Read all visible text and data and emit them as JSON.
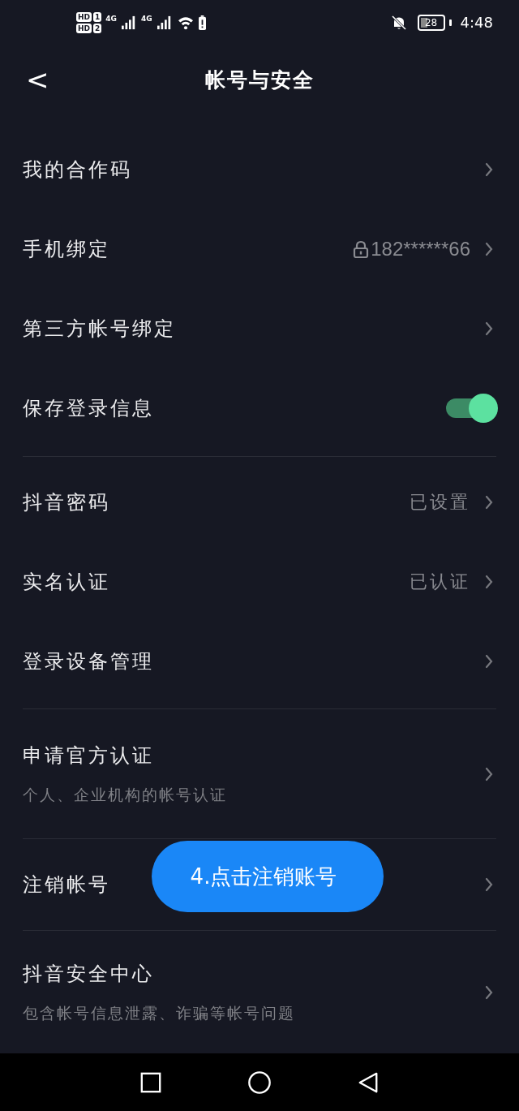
{
  "status_bar": {
    "sim_1": "HD",
    "sim_1_slot": "1",
    "sim_2": "HD",
    "sim_2_slot": "2",
    "network_1": "4G",
    "network_2": "4G",
    "battery": "28",
    "time": "4:48"
  },
  "header": {
    "back": "<",
    "title": "帐号与安全"
  },
  "sections": [
    {
      "rows": [
        {
          "kind": "link",
          "title": "我的合作码"
        },
        {
          "kind": "link",
          "title": "手机绑定",
          "value": "182******66",
          "locked": true
        },
        {
          "kind": "link",
          "title": "第三方帐号绑定"
        },
        {
          "kind": "toggle",
          "title": "保存登录信息",
          "on": true
        }
      ]
    },
    {
      "rows": [
        {
          "kind": "link",
          "title": "抖音密码",
          "value": "已设置"
        },
        {
          "kind": "link",
          "title": "实名认证",
          "value": "已认证"
        },
        {
          "kind": "link",
          "title": "登录设备管理"
        }
      ]
    },
    {
      "rows": [
        {
          "kind": "link",
          "title": "申请官方认证",
          "subtitle": "个人、企业机构的帐号认证"
        }
      ]
    },
    {
      "rows": [
        {
          "kind": "link",
          "title": "注销帐号",
          "callout": "4.点击注销账号"
        }
      ]
    },
    {
      "rows": [
        {
          "kind": "link",
          "title": "抖音安全中心",
          "subtitle": "包含帐号信息泄露、诈骗等帐号问题"
        }
      ]
    }
  ]
}
